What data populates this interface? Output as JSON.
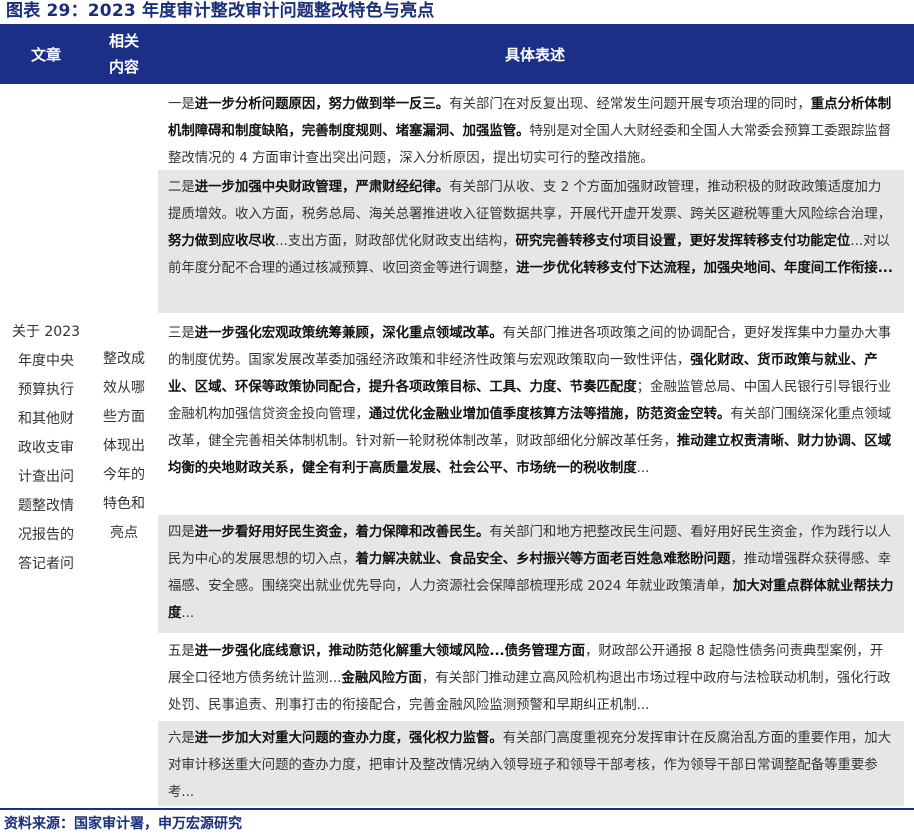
{
  "title": "图表 29：2023 年度审计整改审计问题整改特色与亮点",
  "header": {
    "col1": "文章",
    "col2_line1": "相关",
    "col2_line2": "内容",
    "col3": "具体表述"
  },
  "article": [
    "关于 2023",
    "年度中央",
    "预算执行",
    "和其他财",
    "政收支审",
    "计查出问",
    "题整改情",
    "况报告的",
    "答记者问"
  ],
  "content_label": [
    "整改成",
    "效从哪",
    "些方面",
    "体现出",
    "今年的",
    "特色和",
    "亮点"
  ],
  "rows": [
    {
      "shaded": false,
      "segments": [
        {
          "t": "一是",
          "b": false
        },
        {
          "t": "进一步分析问题原因，努力做到举一反三。",
          "b": true
        },
        {
          "t": "有关部门在对反复出现、经常发生问题开展专项治理的同时，",
          "b": false
        },
        {
          "t": "重点分析体制机制障碍和制度缺陷，完善制度规则、堵塞漏洞、加强监管。",
          "b": true
        },
        {
          "t": "特别是对全国人大财经委和全国人大常委会预算工委跟踪监督整改情况的 4 方面审计查出突出问题，深入分析原因，提出切实可行的整改措施。",
          "b": false
        }
      ]
    },
    {
      "shaded": true,
      "segments": [
        {
          "t": "二是",
          "b": false
        },
        {
          "t": "进一步加强中央财政管理，严肃财经纪律。",
          "b": true
        },
        {
          "t": "有关部门从收、支 2 个方面加强财政管理，推动积极的财政政策适度加力提质增效。收入方面，税务总局、海关总署推进收入征管数据共享，开展代开虚开发票、跨关区避税等重大风险综合治理，",
          "b": false
        },
        {
          "t": "努力做到应收尽收",
          "b": true
        },
        {
          "t": "...支出方面，财政部优化财政支出结构，",
          "b": false
        },
        {
          "t": "研究完善转移支付项目设置，更好发挥转移支付功能定位",
          "b": true
        },
        {
          "t": "...对以前年度分配不合理的通过核减预算、收回资金等进行调整，",
          "b": false
        },
        {
          "t": "进一步优化转移支付下达流程，加强央地间、年度间工作衔接...",
          "b": true
        }
      ]
    },
    {
      "shaded": false,
      "segments": [
        {
          "t": "三是",
          "b": false
        },
        {
          "t": "进一步强化宏观政策统筹兼顾，深化重点领域改革。",
          "b": true
        },
        {
          "t": "有关部门推进各项政策之间的协调配合，更好发挥集中力量办大事的制度优势。国家发展改革委加强经济政策和非经济性政策与宏观政策取向一致性评估，",
          "b": false
        },
        {
          "t": "强化财政、货币政策与就业、产业、区域、环保等政策协同配合，提升各项政策目标、工具、力度、节奏匹配度",
          "b": true
        },
        {
          "t": "；金融监管总局、中国人民银行引导银行业金融机构加强信贷资金投向管理，",
          "b": false
        },
        {
          "t": "通过优化金融业增加值季度核算方法等措施，防范资金空转。",
          "b": true
        },
        {
          "t": "有关部门围绕深化重点领域改革，健全完善相关体制机制。针对新一轮财税体制改革，财政部细化分解改革任务，",
          "b": false
        },
        {
          "t": "推动建立权责清晰、财力协调、区域均衡的央地财政关系，健全有利于高质量发展、社会公平、市场统一的税收制度",
          "b": true
        },
        {
          "t": "...",
          "b": false
        }
      ]
    },
    {
      "shaded": true,
      "segments": [
        {
          "t": "四是",
          "b": false
        },
        {
          "t": "进一步看好用好民生资金，着力保障和改善民生。",
          "b": true
        },
        {
          "t": "有关部门和地方把整改民生问题、看好用好民生资金，作为践行以人民为中心的发展思想的切入点，",
          "b": false
        },
        {
          "t": "着力解决就业、食品安全、乡村振兴等方面老百姓急难愁盼问题",
          "b": true
        },
        {
          "t": "，推动增强群众获得感、幸福感、安全感。围绕突出就业优先导向，人力资源社会保障部梳理形成 2024 年就业政策清单，",
          "b": false
        },
        {
          "t": "加大对重点群体就业帮扶力度",
          "b": true
        },
        {
          "t": "...",
          "b": false
        }
      ]
    },
    {
      "shaded": false,
      "segments": [
        {
          "t": "五是",
          "b": false
        },
        {
          "t": "进一步强化底线意识，推动防范化解重大领域风险...债务管理方面",
          "b": true
        },
        {
          "t": "，财政部公开通报 8 起隐性债务问责典型案例，开展全口径地方债务统计监测...",
          "b": false
        },
        {
          "t": "金融风险方面",
          "b": true
        },
        {
          "t": "，有关部门推动建立高风险机构退出市场过程中政府与法检联动机制，强化行政处罚、民事追责、刑事打击的衔接配合，完善金融风险监测预警和早期纠正机制...",
          "b": false
        }
      ]
    },
    {
      "shaded": true,
      "segments": [
        {
          "t": "六是",
          "b": false
        },
        {
          "t": "进一步加大对重大问题的查办力度，强化权力监督。",
          "b": true
        },
        {
          "t": "有关部门高度重视充分发挥审计在反腐治乱方面的重要作用，加大对审计移送重大问题的查办力度，把审计及整改情况纳入领导班子和领导干部考核，作为领导干部日常调整配备等重要参考...",
          "b": false
        }
      ]
    }
  ],
  "source": "资料来源：国家审计署，申万宏源研究",
  "colors": {
    "header_bg": "#1c2f86",
    "title": "#1a2f7a",
    "shade": "#e6e6e6"
  }
}
